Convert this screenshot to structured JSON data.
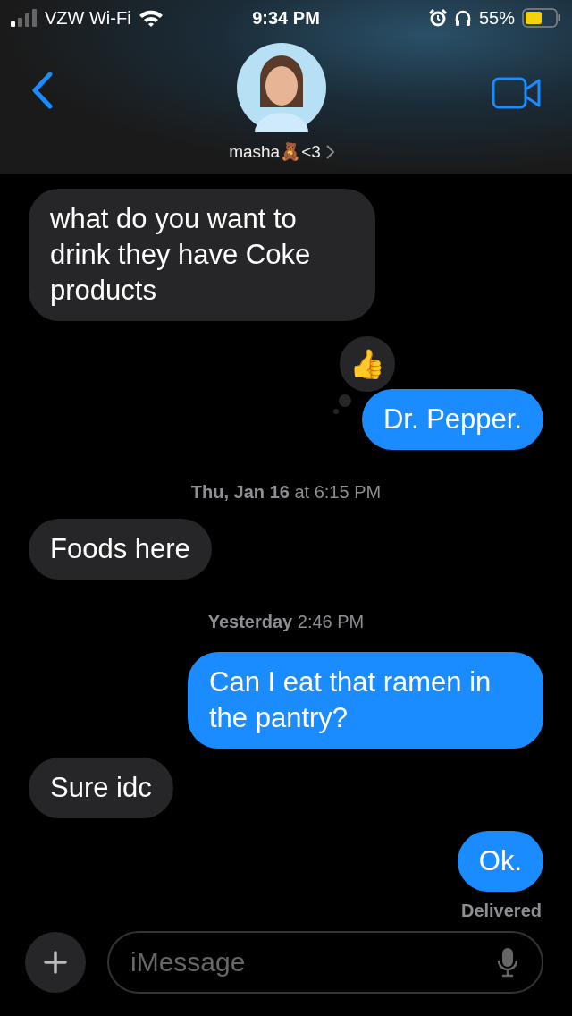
{
  "status_bar": {
    "carrier": "VZW Wi-Fi",
    "time": "9:34 PM",
    "battery": "55%"
  },
  "header": {
    "contact_name": "masha🧸<3"
  },
  "messages": [
    {
      "kind": "received",
      "text": "what do you want to drink they have Coke products"
    },
    {
      "kind": "sent",
      "text": "Dr. Pepper.",
      "reaction": "👍"
    },
    {
      "kind": "timestamp",
      "text": "**Thu, Jan 16** at 6:15 PM"
    },
    {
      "kind": "received",
      "text": "Foods here"
    },
    {
      "kind": "timestamp",
      "text": "**Yesterday** 2:46 PM"
    },
    {
      "kind": "sent",
      "text": "Can I eat that ramen in the pantry?"
    },
    {
      "kind": "received",
      "text": "Sure idc"
    },
    {
      "kind": "sent",
      "text": "Ok."
    },
    {
      "kind": "status",
      "text": "Delivered"
    }
  ],
  "composer": {
    "placeholder": "iMessage"
  }
}
